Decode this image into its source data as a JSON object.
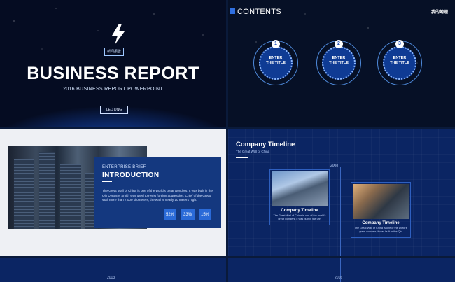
{
  "slide1": {
    "logo_text": "新闻报告",
    "title": "BUSINESS REPORT",
    "subtitle": "2016 BUSINESS REPORT POWERPOINT",
    "button": "LED DNG"
  },
  "slide2": {
    "title": "CONTENTS",
    "brand": "我的地理",
    "items": [
      {
        "num": "1",
        "label_line1": "ENTER",
        "label_line2": "THE TITLE"
      },
      {
        "num": "2",
        "label_line1": "ENTER",
        "label_line2": "THE TITLE"
      },
      {
        "num": "3",
        "label_line1": "ENTER",
        "label_line2": "THE TITLE"
      }
    ]
  },
  "slide3": {
    "kicker": "ENTERPRISE BRIEF",
    "heading": "INTRODUCTION",
    "body": "The Great Wall of China is one of the world's great wonders, It was built in the Qin Dynasty, Smith was used to resist foreign aggression. Chief of the Great Wall more than 7,000 kilometers, the wall is nearly 10 meters high.",
    "stats": [
      "52%",
      "33%",
      "15%"
    ]
  },
  "slide4": {
    "title": "Company Timeline",
    "subtitle": "The Great Wall of China",
    "year_top": "2008",
    "cards": [
      {
        "title": "Company Timeline",
        "desc": "The Great Wall of China is one of the world's great wonders, it was built in the Qin"
      },
      {
        "title": "Company Timeline",
        "desc": "The Great Wall of China is one of the world's great wonders, it was built in the Qin"
      }
    ]
  },
  "bottom": {
    "left_year": "2013",
    "right_year": "2016"
  },
  "colors": {
    "accent": "#2a6ad8",
    "navy": "#0b2563",
    "card_blue": "#14387f"
  }
}
